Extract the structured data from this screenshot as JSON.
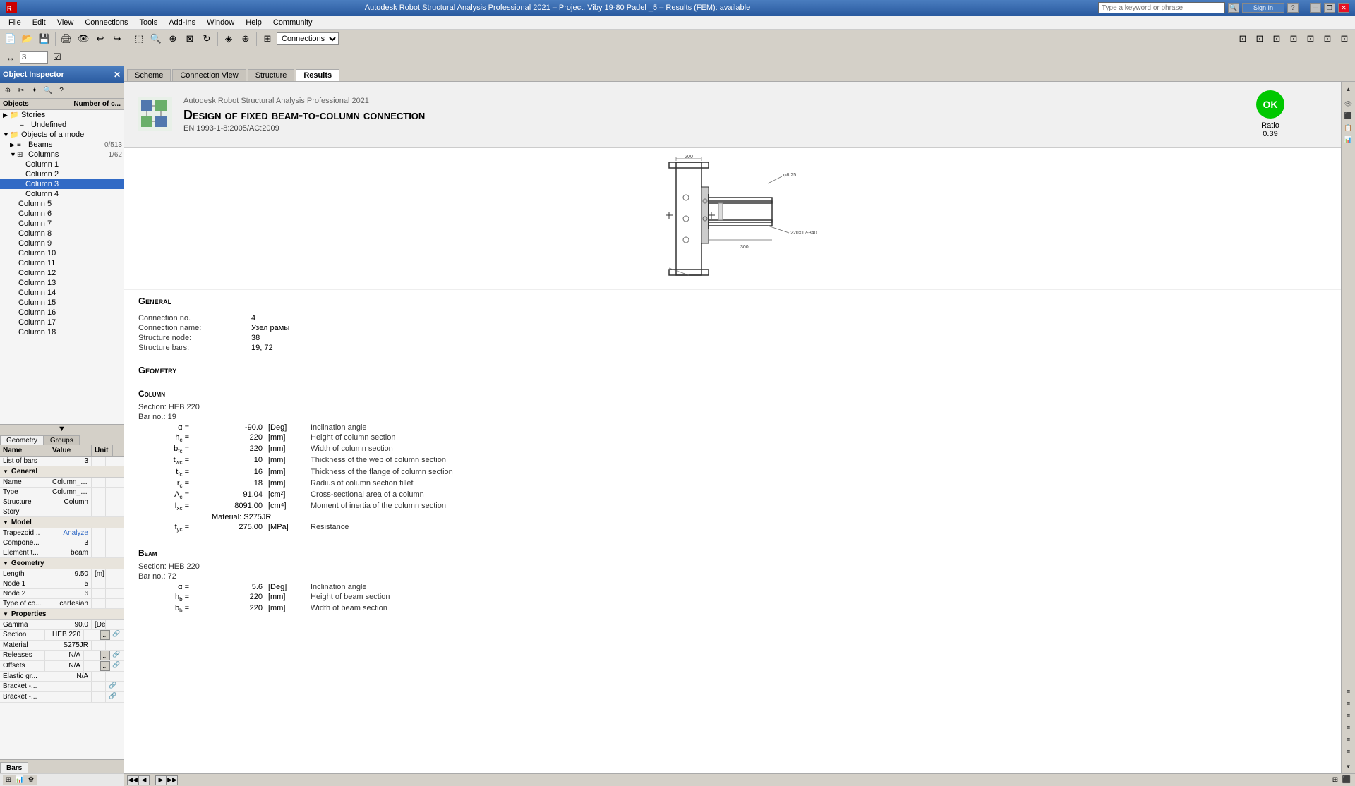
{
  "app": {
    "title": "Autodesk Robot Structural Analysis Professional 2021 – Project: Viby 19-80 Padel _5 – Results (FEM): available",
    "icon": "RSA"
  },
  "titlebar": {
    "close": "✕",
    "maximize": "□",
    "minimize": "─",
    "restore": "❐"
  },
  "menus": [
    "File",
    "Edit",
    "View",
    "Connections",
    "Tools",
    "Add-Ins",
    "Window",
    "Help",
    "Community"
  ],
  "toolbar": {
    "connections_dropdown": "Connections",
    "number_input": "3"
  },
  "object_inspector": {
    "title": "Object Inspector",
    "objects_col": "Objects",
    "number_col": "Number of c...",
    "tree": [
      {
        "level": 1,
        "label": "Stories",
        "indent": 1,
        "expand": false
      },
      {
        "level": 2,
        "label": "Undefined",
        "indent": 2
      },
      {
        "level": 1,
        "label": "Objects of a model",
        "indent": 1,
        "expand": true
      },
      {
        "level": 2,
        "label": "Beams",
        "count": "0/513",
        "indent": 2,
        "expand": false
      },
      {
        "level": 2,
        "label": "Columns",
        "count": "1/62",
        "indent": 2,
        "expand": true
      },
      {
        "level": 3,
        "label": "Column  1",
        "indent": 3
      },
      {
        "level": 3,
        "label": "Column  2",
        "indent": 3
      },
      {
        "level": 3,
        "label": "Column  3",
        "indent": 3,
        "selected": true
      },
      {
        "level": 3,
        "label": "Column  4",
        "indent": 3
      },
      {
        "level": 3,
        "label": "Column  5",
        "indent": 3
      },
      {
        "level": 3,
        "label": "Column  6",
        "indent": 3
      },
      {
        "level": 3,
        "label": "Column  7",
        "indent": 3
      },
      {
        "level": 3,
        "label": "Column  8",
        "indent": 3
      },
      {
        "level": 3,
        "label": "Column  9",
        "indent": 3
      },
      {
        "level": 3,
        "label": "Column  10",
        "indent": 3
      },
      {
        "level": 3,
        "label": "Column  11",
        "indent": 3
      },
      {
        "level": 3,
        "label": "Column  12",
        "indent": 3
      },
      {
        "level": 3,
        "label": "Column  13",
        "indent": 3
      },
      {
        "level": 3,
        "label": "Column  14",
        "indent": 3
      },
      {
        "level": 3,
        "label": "Column  15",
        "indent": 3
      },
      {
        "level": 3,
        "label": "Column  16",
        "indent": 3
      },
      {
        "level": 3,
        "label": "Column  17",
        "indent": 3
      },
      {
        "level": 3,
        "label": "Column  18",
        "indent": 3
      }
    ]
  },
  "geometry_tab": "Geometry",
  "groups_tab": "Groups",
  "properties": {
    "headers": [
      "Name",
      "Value",
      "Unit"
    ],
    "list_of_bars_label": "List of bars",
    "list_of_bars_value": "3",
    "general_group": "General",
    "rows": [
      {
        "name": "Name",
        "value": "Column_Pade...",
        "unit": "",
        "has_actions": false
      },
      {
        "name": "Type",
        "value": "Column_Padel",
        "unit": "",
        "has_actions": false
      },
      {
        "name": "Structure",
        "value": "Column",
        "unit": "",
        "has_actions": false
      },
      {
        "name": "Story",
        "value": "",
        "unit": "",
        "has_actions": false
      }
    ],
    "model_group": "Model",
    "model_rows": [
      {
        "name": "Trapezoid...",
        "value": "Analyze",
        "unit": ""
      },
      {
        "name": "Compone...",
        "value": "3",
        "unit": ""
      },
      {
        "name": "Element t...",
        "value": "beam",
        "unit": ""
      }
    ],
    "geometry_group": "Geometry",
    "geometry_rows": [
      {
        "name": "Length",
        "value": "9.50",
        "unit": "[m]"
      },
      {
        "name": "Node 1",
        "value": "5",
        "unit": ""
      },
      {
        "name": "Node 2",
        "value": "6",
        "unit": ""
      },
      {
        "name": "Type of co...",
        "value": "cartesian",
        "unit": ""
      }
    ],
    "properties_group": "Properties",
    "properties_rows": [
      {
        "name": "Gamma",
        "value": "90.0",
        "unit": "[Deg]"
      },
      {
        "name": "Section",
        "value": "HEB 220",
        "unit": "",
        "has_link": true
      },
      {
        "name": "Material",
        "value": "S275JR",
        "unit": ""
      },
      {
        "name": "Releases",
        "value": "N/A",
        "unit": "",
        "has_link": true
      },
      {
        "name": "Offsets",
        "value": "N/A",
        "unit": "",
        "has_link": true
      },
      {
        "name": "Elastic gr...",
        "value": "N/A",
        "unit": ""
      },
      {
        "name": "Bracket -...",
        "value": "",
        "unit": "",
        "has_link": true
      },
      {
        "name": "Bracket -...",
        "value": "",
        "unit": "",
        "has_link": true
      }
    ]
  },
  "bottom_tabs": [
    "Bars"
  ],
  "bottom_icons": [
    "grid",
    "chart",
    "settings"
  ],
  "tabs": [
    "Scheme",
    "Connection View",
    "Structure",
    "Results"
  ],
  "active_tab": "Results",
  "report": {
    "software": "Autodesk Robot Structural Analysis Professional 2021",
    "title": "Design of fixed beam-to-column connection",
    "standard": "EN 1993-1-8:2005/AC:2009",
    "status": "OK",
    "ratio_label": "Ratio",
    "ratio_value": "0.39",
    "general_section": "General",
    "connection_no_label": "Connection no.",
    "connection_no_value": "4",
    "connection_name_label": "Connection name:",
    "connection_name_value": "Узел рамы",
    "structure_node_label": "Structure node:",
    "structure_node_value": "38",
    "structure_bars_label": "Structure bars:",
    "structure_bars_value": "19, 72",
    "geometry_section": "Geometry",
    "column_section_title": "Column",
    "column_section": "HEB 220",
    "column_bar_no": "19",
    "column_alpha_label": "α =",
    "column_alpha_value": "-90.0",
    "column_alpha_unit": "[Deg]",
    "column_alpha_desc": "Inclination angle",
    "column_hc_label": "h_c =",
    "column_hc_value": "220",
    "column_hc_unit": "[mm]",
    "column_hc_desc": "Height of column section",
    "column_bfc_label": "b_fc =",
    "column_bfc_value": "220",
    "column_bfc_unit": "[mm]",
    "column_bfc_desc": "Width of column section",
    "column_twc_label": "t_wc =",
    "column_twc_value": "10",
    "column_twc_unit": "[mm]",
    "column_twc_desc": "Thickness of the web of column section",
    "column_tfc_label": "t_fc =",
    "column_tfc_value": "16",
    "column_tfc_unit": "[mm]",
    "column_tfc_desc": "Thickness of the flange of column section",
    "column_rc_label": "r_c =",
    "column_rc_value": "18",
    "column_rc_unit": "[mm]",
    "column_rc_desc": "Radius of column section fillet",
    "column_Ac_label": "A_c =",
    "column_Ac_value": "91.04",
    "column_Ac_unit": "[cm²]",
    "column_Ac_desc": "Cross-sectional area of a column",
    "column_Ixc_label": "I_xc =",
    "column_Ixc_value": "8091.00",
    "column_Ixc_unit": "[cm⁴]",
    "column_Ixc_desc": "Moment of inertia of the column section",
    "column_material": "Material: S275JR",
    "column_fyc_label": "f_yc =",
    "column_fyc_value": "275.00",
    "column_fyc_unit": "[MPa]",
    "column_fyc_desc": "Resistance",
    "beam_section_title": "Beam",
    "beam_section": "HEB 220",
    "beam_bar_no": "72",
    "beam_alpha_label": "α =",
    "beam_alpha_value": "5.6",
    "beam_alpha_unit": "[Deg]",
    "beam_alpha_desc": "Inclination angle",
    "beam_hb_label": "h_b =",
    "beam_hb_value": "220",
    "beam_hb_unit": "[mm]",
    "beam_hb_desc": "Height of beam section",
    "beam_bb_label": "b_b =",
    "beam_bb_value": "220",
    "beam_bb_unit": "[mm]",
    "beam_bb_desc": "Width of beam section"
  }
}
